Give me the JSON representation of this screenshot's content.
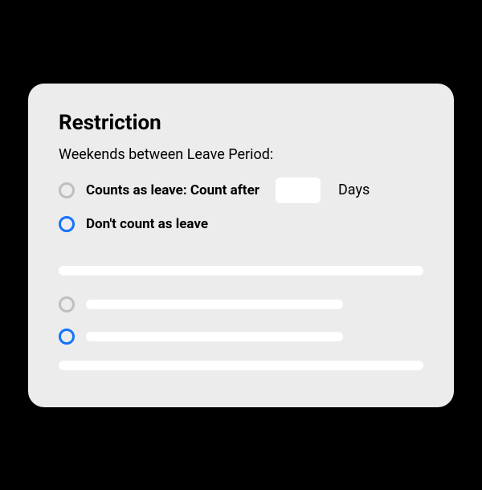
{
  "restriction": {
    "title": "Restriction",
    "subtitle": "Weekends between Leave Period:",
    "options": {
      "counts_as_leave": {
        "label": "Counts as leave: Count after",
        "value": "",
        "suffix": "Days",
        "selected": false
      },
      "dont_count": {
        "label": "Don't count as leave",
        "selected": true
      }
    }
  }
}
